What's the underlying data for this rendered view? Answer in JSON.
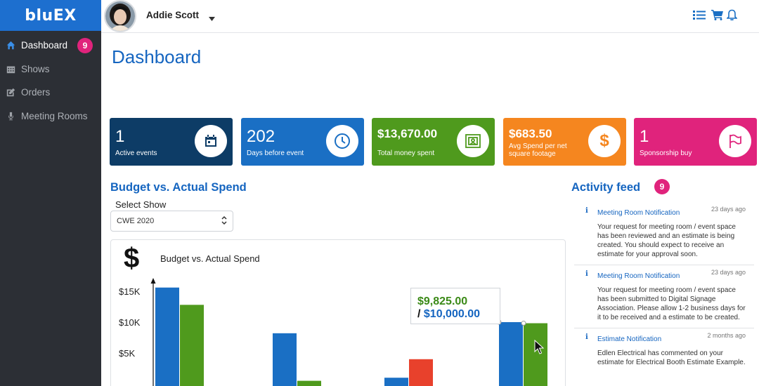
{
  "brand": {
    "logo_text": "bluEX"
  },
  "nav": {
    "items": [
      {
        "label": "Dashboard",
        "icon": "home-icon",
        "active": true,
        "badge": "9"
      },
      {
        "label": "Shows",
        "icon": "calendar-icon"
      },
      {
        "label": "Orders",
        "icon": "edit-icon"
      },
      {
        "label": "Meeting Rooms",
        "icon": "microphone-icon"
      }
    ]
  },
  "topbar": {
    "user_name": "Addie Scott",
    "icons": [
      "list-icon",
      "cart-icon",
      "bell-icon"
    ]
  },
  "page": {
    "title": "Dashboard"
  },
  "stats": [
    {
      "value": "1",
      "label": "Active events",
      "color": "#0d3c66",
      "icon": "calendar-icon"
    },
    {
      "value": "202",
      "label": "Days before event",
      "color": "#1a6fc4",
      "icon": "clock-icon"
    },
    {
      "value": "$13,670.00",
      "label": "Total money spent",
      "color": "#4f9a1d",
      "icon": "booth-icon"
    },
    {
      "value": "$683.50",
      "label": "Avg Spend per net square footage",
      "color": "#f5861f",
      "icon": "dollar-icon"
    },
    {
      "value": "1",
      "label": "Sponsorship buy",
      "color": "#e0237c",
      "icon": "flag-icon"
    }
  ],
  "budget": {
    "section_title": "Budget vs. Actual Spend",
    "select_label": "Select Show",
    "select_value": "CWE 2020",
    "tooltip_actual": "$9,825.00",
    "tooltip_slash": "/",
    "tooltip_budget": "$10,000.00"
  },
  "chart_data": {
    "type": "bar",
    "title": "Budget vs. Actual Spend",
    "symbol": "$",
    "yticks": [
      "$15K",
      "$10K",
      "$5K"
    ],
    "ytick_values": [
      15000,
      10000,
      5000
    ],
    "ylim": [
      0,
      20000
    ],
    "colors": {
      "blue": "#1a6fc4",
      "green": "#4f9a1d",
      "red": "#e8412c"
    },
    "groups": [
      {
        "bars": [
          {
            "value": 15600,
            "color": "blue"
          },
          {
            "value": 12800,
            "color": "green"
          }
        ]
      },
      {
        "bars": [
          {
            "value": 8200,
            "color": "blue"
          },
          {
            "value": 500,
            "color": "green"
          }
        ]
      },
      {
        "bars": [
          {
            "value": 1000,
            "color": "blue"
          },
          {
            "value": 4000,
            "color": "red"
          }
        ]
      },
      {
        "bars": [
          {
            "value": 10000,
            "color": "blue"
          },
          {
            "value": 9825,
            "color": "green"
          }
        ]
      }
    ]
  },
  "activity": {
    "title": "Activity feed",
    "badge": "9",
    "info_glyph": "i",
    "items": [
      {
        "title": "Meeting Room Notification",
        "time": "23 days ago",
        "body": "Your request for meeting room / event space has been reviewed and an estimate is being created. You should expect to receive an estimate for your approval soon."
      },
      {
        "title": "Meeting Room Notification",
        "time": "23 days ago",
        "body": "Your request for meeting room / event space has been submitted to Digital Signage Association. Please allow 1-2 business days for it to be received and a estimate to be created."
      },
      {
        "title": "Estimate Notification",
        "time": "2 months ago",
        "body": "Edlen Electrical has commented on your estimate for Electrical Booth Estimate Example."
      }
    ]
  }
}
